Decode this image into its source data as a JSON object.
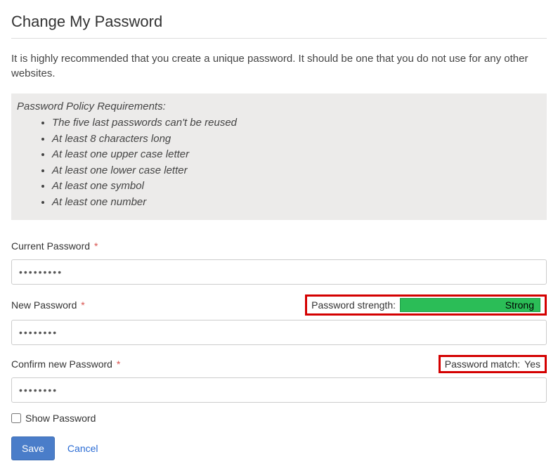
{
  "page": {
    "title": "Change My Password",
    "intro": "It is highly recommended that you create a unique password. It should be one that you do not use for any other websites."
  },
  "policy": {
    "heading": "Password Policy Requirements:",
    "items": [
      "The five last passwords can't be reused",
      "At least 8 characters long",
      "At least one upper case letter",
      "At least one lower case letter",
      "At least one symbol",
      "At least one number"
    ]
  },
  "fields": {
    "current": {
      "label": "Current Password",
      "required_mark": "*",
      "value": "•••••••••"
    },
    "new": {
      "label": "New Password",
      "required_mark": "*",
      "value": "••••••••"
    },
    "confirm": {
      "label": "Confirm new Password",
      "required_mark": "*",
      "value": "••••••••"
    }
  },
  "strength": {
    "label": "Password strength:",
    "level": "Strong",
    "color": "#2bbd57"
  },
  "match": {
    "label": "Password match: ",
    "value": "Yes"
  },
  "show_password": {
    "label": "Show Password",
    "checked": false
  },
  "actions": {
    "save": "Save",
    "cancel": "Cancel"
  }
}
